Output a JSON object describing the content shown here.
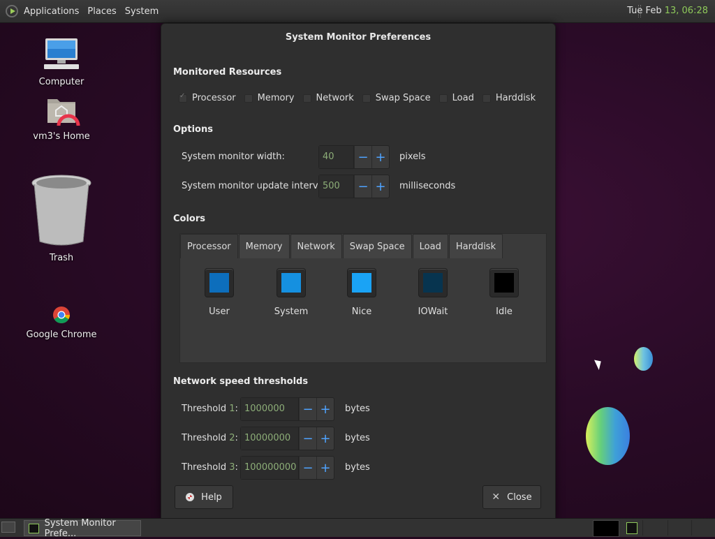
{
  "top_panel": {
    "menus": [
      "Applications",
      "Places",
      "System"
    ],
    "clock_prefix": "Tue Feb ",
    "clock_highlight": "13, 06:28"
  },
  "desktop": {
    "icons": [
      {
        "label": "Computer",
        "icon": "computer-icon"
      },
      {
        "label": "vm3's Home",
        "icon": "home-folder-icon"
      },
      {
        "label": "Trash",
        "icon": "trash-icon"
      },
      {
        "label": "Google Chrome",
        "icon": "chrome-icon"
      }
    ]
  },
  "dialog": {
    "title": "System Monitor Preferences",
    "monitored": {
      "heading": "Monitored Resources",
      "items": [
        {
          "label": "Processor",
          "checked": true
        },
        {
          "label": "Memory",
          "checked": false
        },
        {
          "label": "Network",
          "checked": false
        },
        {
          "label": "Swap Space",
          "checked": false
        },
        {
          "label": "Load",
          "checked": false
        },
        {
          "label": "Harddisk",
          "checked": false
        }
      ]
    },
    "options": {
      "heading": "Options",
      "width_label": "System monitor width:",
      "width_value": "40",
      "width_unit": "pixels",
      "interval_label": "System monitor update interval:",
      "interval_value": "500",
      "interval_unit": "milliseconds"
    },
    "colors": {
      "heading": "Colors",
      "tabs": [
        "Processor",
        "Memory",
        "Network",
        "Swap Space",
        "Load",
        "Harddisk"
      ],
      "active_tab": "Processor",
      "swatches": [
        {
          "label": "User",
          "color": "#0d6ebc"
        },
        {
          "label": "System",
          "color": "#1590e0"
        },
        {
          "label": "Nice",
          "color": "#1aa3f5"
        },
        {
          "label": "IOWait",
          "color": "#07344f"
        },
        {
          "label": "Idle",
          "color": "#000000"
        }
      ]
    },
    "network": {
      "heading": "Network speed thresholds",
      "thresholds": [
        {
          "label_prefix": "Threshold ",
          "num": "1",
          "label_suffix": ":",
          "value": "1000000",
          "unit": "bytes"
        },
        {
          "label_prefix": "Threshold ",
          "num": "2",
          "label_suffix": ":",
          "value": "10000000",
          "unit": "bytes"
        },
        {
          "label_prefix": "Threshold ",
          "num": "3",
          "label_suffix": ":",
          "value": "100000000",
          "unit": "bytes"
        }
      ]
    },
    "help_label": "Help",
    "close_label": "Close"
  },
  "bottom_panel": {
    "task_label": "System Monitor Prefe..."
  },
  "colors": {
    "accent_green": "#8ec95a",
    "spin_blue": "#4fa3ff"
  }
}
